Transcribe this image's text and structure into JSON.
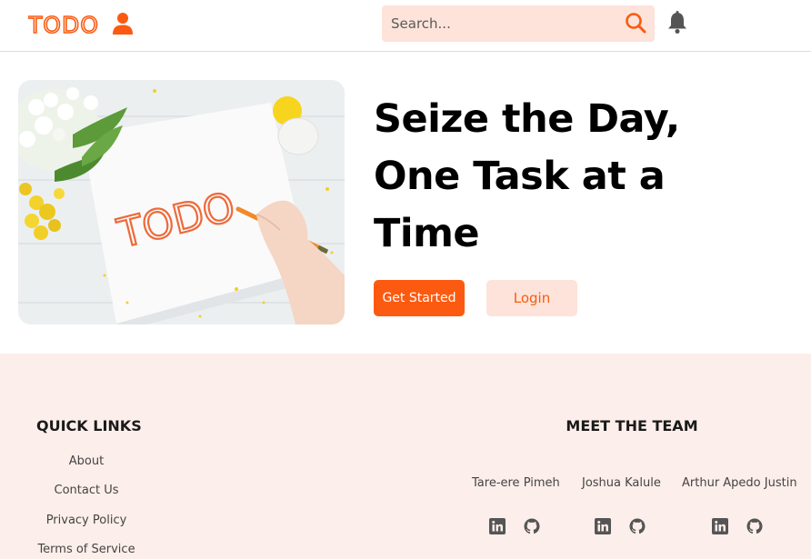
{
  "header": {
    "logo_text": "TODO",
    "search_placeholder": "Search..."
  },
  "hero": {
    "title": "Seize the Day, One Task at a Time",
    "get_started_label": "Get Started",
    "login_label": "Login",
    "image_text": "TODO"
  },
  "footer": {
    "quick_links_title": "QUICK LINKS",
    "links": [
      "About",
      "Contact Us",
      "Privacy Policy",
      "Terms of Service"
    ],
    "team_title": "MEET THE TEAM",
    "team": [
      {
        "name": "Tare-ere Pimeh"
      },
      {
        "name": "Joshua Kalule"
      },
      {
        "name": "Arthur Apedo Justin"
      }
    ]
  },
  "colors": {
    "accent": "#fc5a10",
    "accent_light": "#fde3da",
    "footer_bg": "#fceeea"
  },
  "icons": [
    "user-icon",
    "search-icon",
    "bell-icon",
    "linkedin-icon",
    "github-icon"
  ]
}
